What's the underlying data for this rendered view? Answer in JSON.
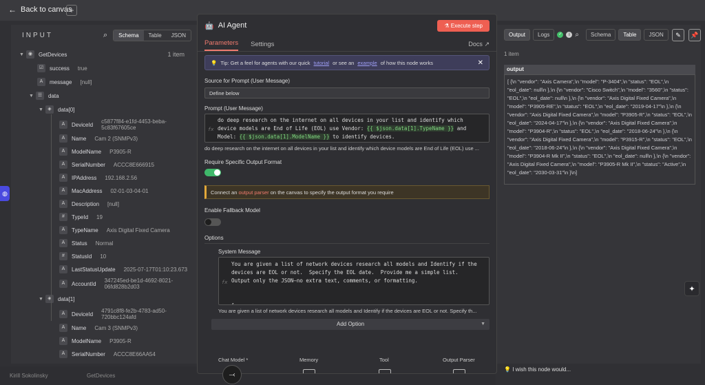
{
  "topbar": {
    "back_label": "Back to canvas"
  },
  "input": {
    "title": "INPUT",
    "tabs": [
      "Schema",
      "Table",
      "JSON"
    ],
    "node_name": "GetDevices",
    "count": "1 item",
    "fields": {
      "success": {
        "key": "success",
        "val": "true"
      },
      "message": {
        "key": "message",
        "val": "[null]"
      },
      "data": {
        "key": "data"
      }
    },
    "items": [
      {
        "label": "data[0]",
        "fields": [
          [
            "DeviceId",
            "c5877f84-e1fd-4453-beba-5c83f67605ce"
          ],
          [
            "Name",
            "Cam 2 (SNMPv3)"
          ],
          [
            "ModelName",
            "P3905-R"
          ],
          [
            "SerialNumber",
            "ACCC8E666915"
          ],
          [
            "IPAddress",
            "192.168.2.56"
          ],
          [
            "MacAddress",
            "02-01-03-04-01"
          ],
          [
            "Description",
            "[null]"
          ],
          [
            "TypeId",
            "19"
          ],
          [
            "TypeName",
            "Axis Digital Fixed Camera"
          ],
          [
            "Status",
            "Normal"
          ],
          [
            "StatusId",
            "10"
          ],
          [
            "LastStatusUpdate",
            "2025-07-17T01:10:23.673"
          ],
          [
            "AccountId",
            "347245ed-be1d-4692-8021-06fd828b2d03"
          ]
        ]
      },
      {
        "label": "data[1]",
        "fields": [
          [
            "DeviceId",
            "4791c8f8-fe2b-4783-ad50-720bbc124afd"
          ],
          [
            "Name",
            "Cam 3 (SNMPv3)"
          ],
          [
            "ModelName",
            "P3905-R"
          ],
          [
            "SerialNumber",
            "ACCC8E66AA54"
          ]
        ]
      }
    ]
  },
  "modal": {
    "title": "AI Agent",
    "execute_label": "Execute step",
    "tabs": [
      "Parameters",
      "Settings"
    ],
    "docs_label": "Docs",
    "tip": {
      "text1": "Tip: Get a feel for agents with our quick",
      "link1": "tutorial",
      "text2": "or see an",
      "link2": "example",
      "text3": "of how this node works"
    },
    "source_label": "Source for Prompt (User Message)",
    "source_value": "Define below",
    "prompt_label": "Prompt (User Message)",
    "prompt_code": {
      "part1": "do deep research on the internet on all devices in your list and identify which device models are End of Life (EOL) use Vendor: ",
      "expr1": "{{ $json.data[1].TypeName }}",
      "part2": " and Model: ",
      "expr2": "{{ $json.data[1].ModelName }}",
      "part3": " to identify devices."
    },
    "prompt_resolved": "do deep research on the internet on all devices in your list and identify which device models are End of Life (EOL) use ...",
    "require_output_label": "Require Specific Output Format",
    "notice": {
      "text1": "Connect an",
      "link": "output parser",
      "text2": "on the canvas to specify the output format you require"
    },
    "fallback_label": "Enable Fallback Model",
    "options_label": "Options",
    "system_message_label": "System Message",
    "system_code": "You are given a list of network devices research all models and Identify if the devices are EOL or not.  Specify the EOL date.  Provide me a simple list.  Output only the JSON—no extra text, comments, or formatting.\n\n\n[",
    "system_resolved": "You are given a list of network devices research all models and Identify if the devices are EOL or not.  Specify th...",
    "add_option_label": "Add Option",
    "subnodes": [
      "Chat Model *",
      "Memory",
      "Tool",
      "Output Parser"
    ]
  },
  "output": {
    "tabs": [
      "Output",
      "Logs"
    ],
    "view_tabs": [
      "Schema",
      "Table",
      "JSON"
    ],
    "count": "1 item",
    "column": "output",
    "value": "[ {\\n    \"vendor\": \"Axis Camera\",\\n    \"model\": \"P-3404\",\\n    \"status\": \"EOL\",\\n    \"eol_date\": null\\n  },\\n  {\\n    \"vendor\": \"Cisco Switch\",\\n    \"model\": \"3560\",\\n    \"status\": \"EOL\",\\n    \"eol_date\": null\\n  },\\n  {\\n    \"vendor\": \"Axis Digital Fixed Camera\",\\n    \"model\": \"P3905-RE\",\\n    \"status\": \"EOL\",\\n    \"eol_date\": \"2019-04-17\"\\n  },\\n  {\\n    \"vendor\": \"Axis Digital Fixed Camera\",\\n    \"model\": \"P3905-R\",\\n    \"status\": \"EOL\",\\n    \"eol_date\": \"2024-04-17\"\\n  },\\n  {\\n    \"vendor\": \"Axis Digital Fixed Camera\",\\n    \"model\": \"P3904-R\",\\n    \"status\": \"EOL\",\\n    \"eol_date\": \"2018-06-24\"\\n  },\\n  {\\n    \"vendor\": \"Axis Digital Fixed Camera\",\\n    \"model\": \"P3915-R\",\\n    \"status\": \"EOL\",\\n    \"eol_date\": \"2018-06-24\"\\n  },\\n  {\\n    \"vendor\": \"Axis Digital Fixed Camera\",\\n    \"model\": \"P3904-R Mk II\",\\n    \"status\": \"EOL\",\\n    \"eol_date\": null\\n  },\\n  {\\n    \"vendor\": \"Axis Digital Fixed Camera\",\\n    \"model\": \"P3905-R Mk II\",\\n    \"status\": \"Active\",\\n    \"eol_date\": \"2030-03-31\"\\n  }\\n]",
    "wish_label": "I wish this node would..."
  },
  "bottom": {
    "user": "Kirill Sokolinsky",
    "node": "GetDevices"
  },
  "colors": {
    "accent": "#ee5f52",
    "toggle_on": "#3fb86a",
    "tip_bg": "#3e3d5a",
    "notice_border": "#e2a83a"
  }
}
